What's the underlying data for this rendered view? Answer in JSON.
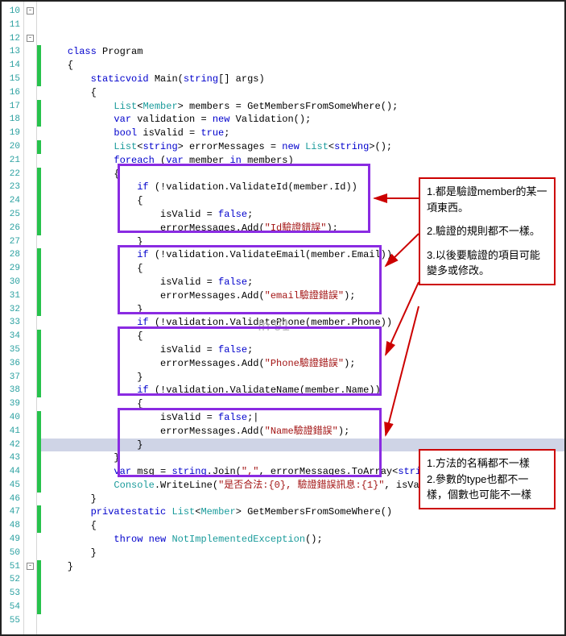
{
  "lines": {
    "numbers": [
      "10",
      "11",
      "12",
      "13",
      "14",
      "15",
      "16",
      "17",
      "18",
      "19",
      "20",
      "21",
      "22",
      "23",
      "24",
      "25",
      "26",
      "27",
      "28",
      "29",
      "30",
      "31",
      "32",
      "33",
      "34",
      "35",
      "36",
      "37",
      "38",
      "39",
      "40",
      "41",
      "42",
      "43",
      "44",
      "45",
      "46",
      "47",
      "48",
      "49",
      "50",
      "51",
      "52",
      "53",
      "54",
      "55"
    ],
    "fold": {
      "10": "minus",
      "12": "minus",
      "51": "minus"
    },
    "changed": [
      13,
      14,
      15,
      17,
      18,
      20,
      22,
      23,
      24,
      25,
      26,
      28,
      29,
      30,
      31,
      32,
      34,
      35,
      36,
      37,
      38,
      40,
      41,
      42,
      43,
      44,
      45,
      47,
      48,
      51,
      52,
      53,
      54
    ]
  },
  "code": {
    "l10": {
      "indent": "    ",
      "kw1": "class",
      "rest": " Program"
    },
    "l11": "    {",
    "l12": {
      "indent": "        ",
      "kw1": "static",
      "kw2": "void",
      "name": " Main(",
      "kw3": "string",
      "rest": "[] args)"
    },
    "l13": "        {",
    "l14": {
      "indent": "            ",
      "type1": "List",
      "lt": "<",
      "type2": "Member",
      "gt": ">",
      "rest": " members = GetMembersFromSomeWhere();"
    },
    "l15": {
      "indent": "            ",
      "kw1": "var",
      "rest1": " validation = ",
      "kw2": "new",
      "rest2": " Validation();"
    },
    "l16": "",
    "l17": {
      "indent": "            ",
      "kw1": "bool",
      "rest1": " isValid = ",
      "kw2": "true",
      "rest2": ";"
    },
    "l18": {
      "indent": "            ",
      "type1": "List",
      "lt": "<",
      "kw1": "string",
      "gt": ">",
      "rest1": " errorMessages = ",
      "kw2": "new",
      "sp": " ",
      "type2": "List",
      "lt2": "<",
      "kw3": "string",
      "gt2": ">();"
    },
    "l19": "",
    "l20": {
      "indent": "            ",
      "kw1": "foreach",
      "rest1": " (",
      "kw2": "var",
      "rest2": " member ",
      "kw3": "in",
      "rest3": " members)"
    },
    "l21": "            {",
    "l22": {
      "indent": "                ",
      "kw1": "if",
      "rest": " (!validation.ValidateId(member.Id))"
    },
    "l23": "                {",
    "l24": {
      "indent": "                    ",
      "rest1": "isValid = ",
      "kw1": "false",
      "rest2": ";"
    },
    "l25": {
      "indent": "                    ",
      "rest1": "errorMessages.Add(",
      "str": "\"Id驗證錯誤\"",
      "rest2": ");"
    },
    "l26": "                }",
    "l27": "",
    "l28": {
      "indent": "                ",
      "kw1": "if",
      "rest": " (!validation.ValidateEmail(member.Email))"
    },
    "l29": "                {",
    "l30": {
      "indent": "                    ",
      "rest1": "isValid = ",
      "kw1": "false",
      "rest2": ";"
    },
    "l31": {
      "indent": "                    ",
      "rest1": "errorMessages.Add(",
      "str": "\"email驗證錯誤\"",
      "rest2": ");"
    },
    "l32": "                }",
    "l33": "",
    "l34": {
      "indent": "                ",
      "kw1": "if",
      "rest": " (!validation.ValidatePhone(member.Phone))"
    },
    "l35": "                {",
    "l36": {
      "indent": "                    ",
      "rest1": "isValid = ",
      "kw1": "false",
      "rest2": ";"
    },
    "l37": {
      "indent": "                    ",
      "rest1": "errorMessages.Add(",
      "str": "\"Phone驗證錯誤\"",
      "rest2": ");"
    },
    "l38": "                }",
    "l39": "",
    "l40": {
      "indent": "                ",
      "kw1": "if",
      "rest": " (!validation.ValidateName(member.Name))"
    },
    "l41": "                {",
    "l42": {
      "indent": "                    ",
      "rest1": "isValid = ",
      "kw1": "false",
      "rest2": ";|"
    },
    "l43": {
      "indent": "                    ",
      "rest1": "errorMessages.Add(",
      "str": "\"Name驗證錯誤\"",
      "rest2": ");"
    },
    "l44": "                }",
    "l45": "            }",
    "l46": "",
    "l47": {
      "indent": "            ",
      "kw1": "var",
      "rest1": " msg = ",
      "kw2": "string",
      "rest2": ".Join(",
      "str": "\",\"",
      "rest3": ", errorMessages.ToArray<",
      "kw3": "string",
      "rest4": ">());"
    },
    "l48": {
      "indent": "            ",
      "type1": "Console",
      "rest1": ".WriteLine(",
      "str": "\"是否合法:{0}, 驗證錯誤訊息:{1}\"",
      "rest2": ", isValid.ToString(), msg);"
    },
    "l49": "        }",
    "l50": "",
    "l51": {
      "indent": "        ",
      "kw1": "private",
      "kw2": "static",
      "sp": " ",
      "type1": "List",
      "lt": "<",
      "type2": "Member",
      "gt": ">",
      "rest": " GetMembersFromSomeWhere()"
    },
    "l52": "        {",
    "l53": {
      "indent": "            ",
      "kw1": "throw",
      "sp": " ",
      "kw2": "new",
      "sp2": " ",
      "type1": "NotImplementedException",
      "rest": "();"
    },
    "l54": "        }",
    "l55": "    }"
  },
  "annot1": {
    "line1": "1.都是驗證member的某一項東西。",
    "line2": "2.驗證的規則都不一樣。",
    "line3": "3.以後要驗證的項目可能變多或修改。"
  },
  "annot2": {
    "line1": "1.方法的名稱都不一樣",
    "line2": "2.參數的type也都不一樣，個數也可能不一樣"
  },
  "watermark": "In 91"
}
